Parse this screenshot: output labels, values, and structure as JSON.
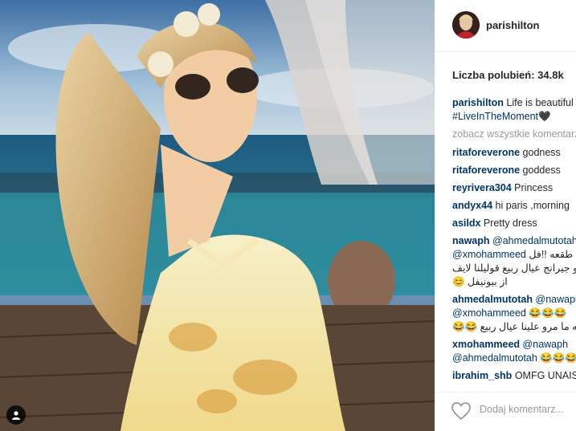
{
  "post": {
    "username": "parishilton",
    "likes_label": "Liczba polubień: 34.8k",
    "caption": {
      "user": "parishilton",
      "text": "Life is beautiful",
      "hashtag": "#LiveInTheMoment",
      "emoji": "🖤"
    },
    "view_all": "zobacz wszystkie komentarze",
    "comments": [
      {
        "user": "ritaforeverone",
        "text": "godness"
      },
      {
        "user": "ritaforeverone",
        "text": "goddess"
      },
      {
        "user": "reyrivera304",
        "text": "Princess"
      },
      {
        "user": "andyx44",
        "text": "hi paris ,morning"
      },
      {
        "user": "asildx",
        "text": "Pretty dress"
      }
    ],
    "arabic_comments": [
      {
        "user": "nawaph",
        "mention1": "@ahmedalmutotah",
        "mention2": "@xmohammeed",
        "line1": "ام طقعه !!فل",
        "line2": "يسارو جيرانج عيال ربيع قوليلنا لايف",
        "line3": "از بيونيفل 😊"
      },
      {
        "user": "ahmedalmutotah",
        "mention1": "@nawaph",
        "mention2": "@xmohammeed",
        "emojis": "😂😂😂",
        "line1": "ماشاءالله ما مرو علينا عيال ربيع 😂😂"
      }
    ],
    "comment_x": {
      "user": "xmohammeed",
      "mention1": "@nawaph",
      "mention2": "@ahmedalmutotah",
      "emojis": "😂😂😂"
    },
    "comment_last": {
      "user": "ibrahim_shb",
      "text": "OMFG UNAISE"
    },
    "add_comment_placeholder": "Dodaj komentarz..."
  },
  "icons": {
    "user_tag": "person-icon",
    "like": "heart-icon"
  }
}
